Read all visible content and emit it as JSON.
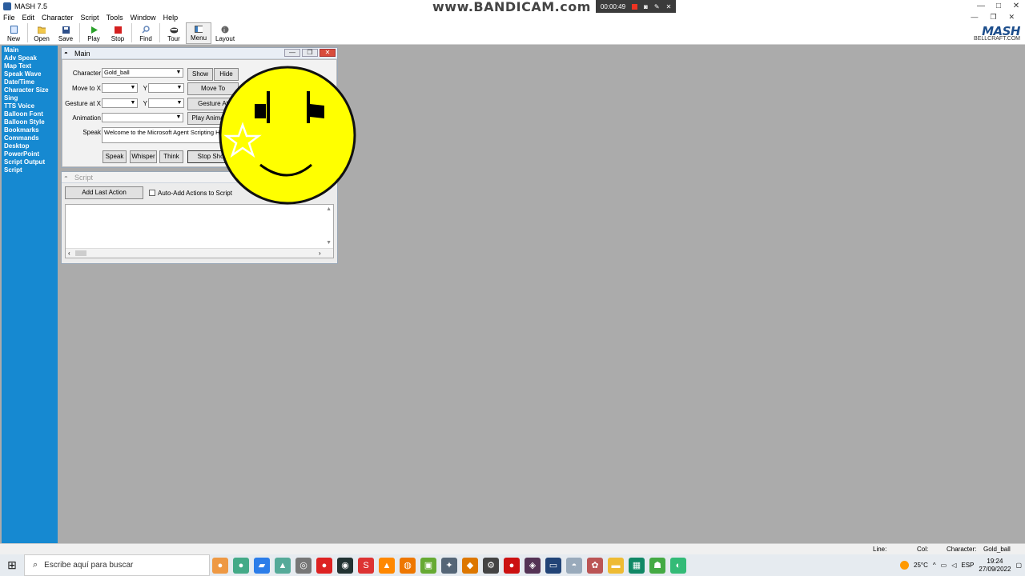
{
  "window": {
    "title": "MASH 7.5"
  },
  "recorder": {
    "brand": "www.BANDICAM.com",
    "timer": "00:00:49"
  },
  "menu": [
    "File",
    "Edit",
    "Character",
    "Script",
    "Tools",
    "Window",
    "Help"
  ],
  "toolbar": {
    "items": [
      {
        "label": "New",
        "icon": "new-file-icon"
      },
      {
        "label": "Open",
        "icon": "open-folder-icon"
      },
      {
        "label": "Save",
        "icon": "save-disk-icon"
      },
      {
        "label": "Play",
        "icon": "play-icon"
      },
      {
        "label": "Stop",
        "icon": "stop-icon"
      },
      {
        "label": "Find",
        "icon": "find-icon"
      },
      {
        "label": "Tour",
        "icon": "tour-icon"
      },
      {
        "label": "Menu",
        "icon": "menu-icon"
      },
      {
        "label": "Layout",
        "icon": "layout-icon"
      }
    ],
    "logo_text": "MASH",
    "logo_sub": "BELLCRAFT.COM"
  },
  "sidebar": {
    "items": [
      "Main",
      "Adv Speak",
      "Map Text",
      "Speak Wave",
      "Date/Time",
      "Character Size",
      "Sing",
      "TTS Voice",
      "Balloon Font",
      "Balloon Style",
      "Bookmarks",
      "Commands",
      "Desktop",
      "PowerPoint",
      "Script Output",
      "Script"
    ]
  },
  "main_window": {
    "title": "Main",
    "character_label": "Character",
    "character_value": "Gold_ball",
    "show": "Show",
    "hide": "Hide",
    "moveto_label": "Move to X",
    "y_label": "Y",
    "moveto_button": "Move To",
    "gesture_label": "Gesture at X",
    "gesture_button": "Gesture At",
    "animation_label": "Animation",
    "play_animation_button": "Play Animation",
    "speak_label": "Speak",
    "speak_text": "Welcome to the Microsoft Agent Scripting Helper",
    "speak_button": "Speak",
    "whisper_button": "Whisper",
    "think_button": "Think",
    "stop_show_button": "Stop Show"
  },
  "script_window": {
    "title": "Script",
    "add_last_action": "Add Last Action",
    "auto_add_label": "Auto-Add Actions to Script"
  },
  "statusbar": {
    "line_label": "Line:",
    "col_label": "Col:",
    "character_label": "Character:",
    "character_value": "Gold_ball"
  },
  "taskbar": {
    "search_placeholder": "Escribe aquí para buscar",
    "temperature": "25°C",
    "language": "ESP",
    "time": "19:24",
    "date": "27/09/2022"
  },
  "colors": {
    "sidebar": "#1689d1",
    "smiley": "#ffff00",
    "desktop": "#ababab"
  }
}
